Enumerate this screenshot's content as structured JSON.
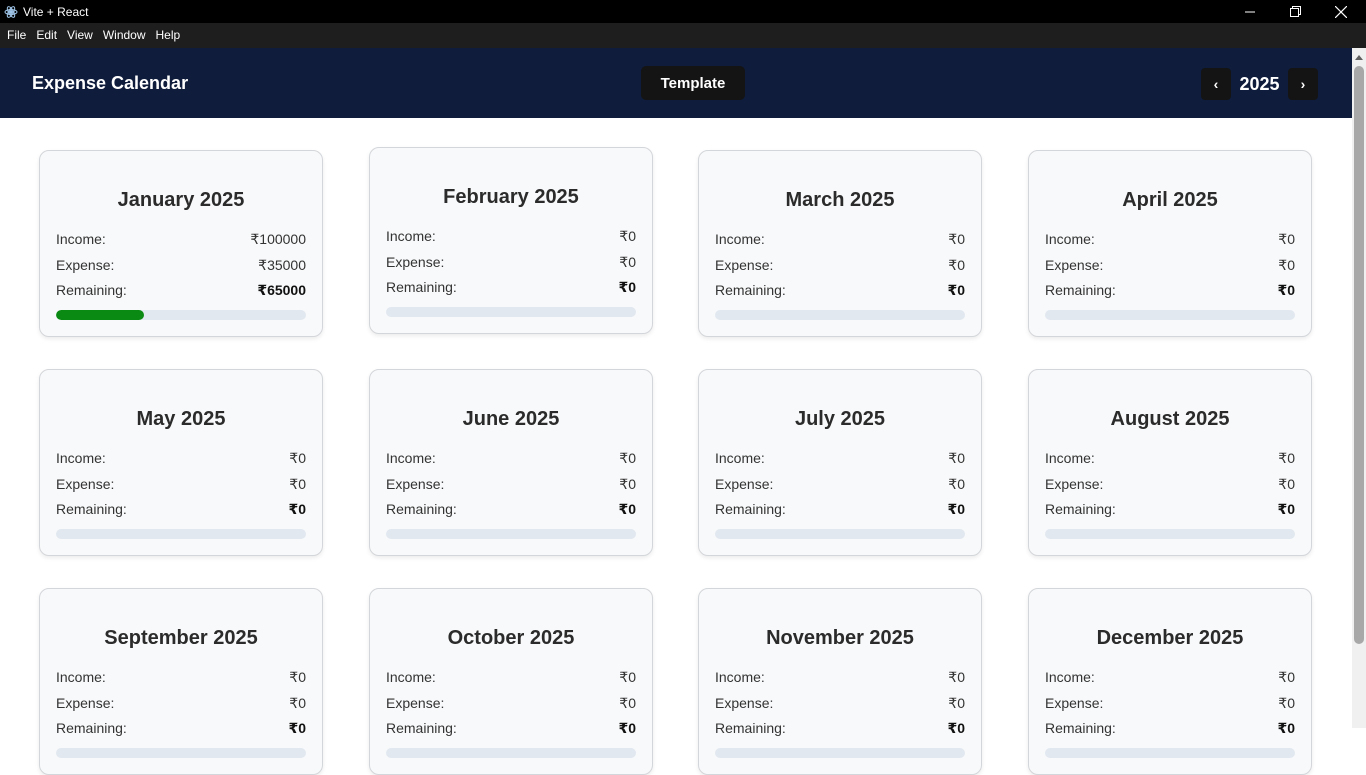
{
  "window": {
    "title": "Vite + React"
  },
  "menu": [
    "File",
    "Edit",
    "View",
    "Window",
    "Help"
  ],
  "header": {
    "title": "Expense Calendar",
    "template_label": "Template",
    "prev": "‹",
    "next": "›",
    "year": "2025"
  },
  "labels": {
    "income": "Income:",
    "expense": "Expense:",
    "remaining": "Remaining:"
  },
  "colors": {
    "header_bg": "#0f1c3c",
    "progress_fill": "#0a8a12",
    "progress_track": "#e2e8f0"
  },
  "months": [
    {
      "name": "January 2025",
      "income": "₹100000",
      "expense": "₹35000",
      "remaining": "₹65000",
      "spent_fraction": 0.35
    },
    {
      "name": "February 2025",
      "income": "₹0",
      "expense": "₹0",
      "remaining": "₹0",
      "spent_fraction": 0
    },
    {
      "name": "March 2025",
      "income": "₹0",
      "expense": "₹0",
      "remaining": "₹0",
      "spent_fraction": 0
    },
    {
      "name": "April 2025",
      "income": "₹0",
      "expense": "₹0",
      "remaining": "₹0",
      "spent_fraction": 0
    },
    {
      "name": "May 2025",
      "income": "₹0",
      "expense": "₹0",
      "remaining": "₹0",
      "spent_fraction": 0
    },
    {
      "name": "June 2025",
      "income": "₹0",
      "expense": "₹0",
      "remaining": "₹0",
      "spent_fraction": 0
    },
    {
      "name": "July 2025",
      "income": "₹0",
      "expense": "₹0",
      "remaining": "₹0",
      "spent_fraction": 0
    },
    {
      "name": "August 2025",
      "income": "₹0",
      "expense": "₹0",
      "remaining": "₹0",
      "spent_fraction": 0
    },
    {
      "name": "September 2025",
      "income": "₹0",
      "expense": "₹0",
      "remaining": "₹0",
      "spent_fraction": 0
    },
    {
      "name": "October 2025",
      "income": "₹0",
      "expense": "₹0",
      "remaining": "₹0",
      "spent_fraction": 0
    },
    {
      "name": "November 2025",
      "income": "₹0",
      "expense": "₹0",
      "remaining": "₹0",
      "spent_fraction": 0
    },
    {
      "name": "December 2025",
      "income": "₹0",
      "expense": "₹0",
      "remaining": "₹0",
      "spent_fraction": 0
    }
  ]
}
